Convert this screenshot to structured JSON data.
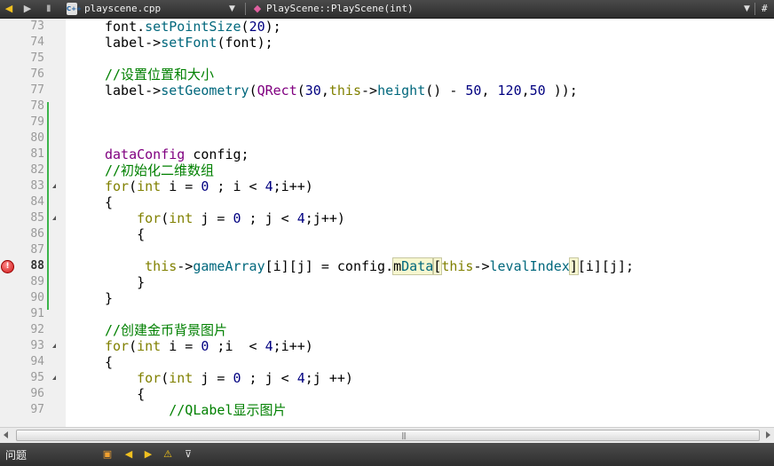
{
  "tabbar": {
    "tabs": [
      {
        "label": "playscene.cpp",
        "active": true
      },
      {
        "label": "PlayScene::PlayScene(int)",
        "active": false
      }
    ],
    "icons": [
      "back-arrow-icon",
      "forward-arrow-icon",
      "lock-icon",
      "cpp-file-icon",
      "function-icon",
      "split-icon"
    ],
    "right_glyph": "#"
  },
  "editor": {
    "current_line": 88,
    "breakpoint_line": 88,
    "colors": {
      "keyword": "#808000",
      "class": "#800080",
      "number": "#000080",
      "comment": "#008000",
      "function": "#00677c",
      "changebar": "#3cb44b"
    },
    "lines": [
      {
        "n": "73",
        "code": "font.setPointSize(20);"
      },
      {
        "n": "74",
        "code": "label->setFont(font);"
      },
      {
        "n": "75",
        "code": ""
      },
      {
        "n": "76",
        "code": "//设置位置和大小"
      },
      {
        "n": "77",
        "code": "label->setGeometry(QRect(30,this->height() - 50, 120,50 ));"
      },
      {
        "n": "78",
        "code": ""
      },
      {
        "n": "79",
        "code": ""
      },
      {
        "n": "80",
        "code": ""
      },
      {
        "n": "81",
        "code": "dataConfig config;"
      },
      {
        "n": "82",
        "code": "//初始化二维数组"
      },
      {
        "n": "83",
        "code": "for(int i = 0 ; i < 4;i++)"
      },
      {
        "n": "84",
        "code": "{"
      },
      {
        "n": "85",
        "code": "    for(int j = 0 ; j < 4;j++)"
      },
      {
        "n": "86",
        "code": "    {"
      },
      {
        "n": "87",
        "code": ""
      },
      {
        "n": "88",
        "code": "     this->gameArray[i][j] = config.mData[this->levalIndex][i][j];"
      },
      {
        "n": "89",
        "code": "    }"
      },
      {
        "n": "90",
        "code": "}"
      },
      {
        "n": "91",
        "code": ""
      },
      {
        "n": "92",
        "code": "//创建金币背景图片"
      },
      {
        "n": "93",
        "code": "for(int i = 0 ;i  < 4;i++)"
      },
      {
        "n": "94",
        "code": "{"
      },
      {
        "n": "95",
        "code": "    for(int j = 0 ; j < 4;j ++)"
      },
      {
        "n": "96",
        "code": "    {"
      },
      {
        "n": "97",
        "code": "        //QLabel显示图片"
      }
    ]
  },
  "statusbar": {
    "label": "问题",
    "icons": [
      "build-icon",
      "prev-issue-icon",
      "next-issue-icon",
      "warning-icon",
      "filter-icon"
    ]
  }
}
